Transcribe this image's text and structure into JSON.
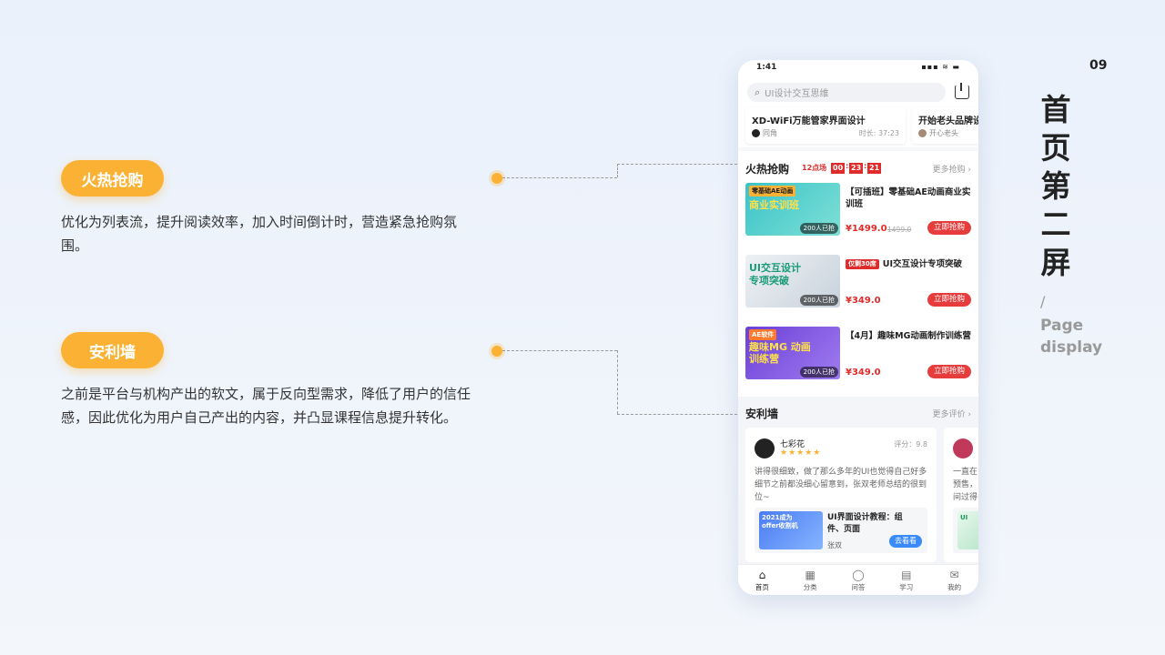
{
  "page_number": "09",
  "title_chars": [
    "首",
    "页",
    "第",
    "二",
    "屏"
  ],
  "subtitle_slash": "/",
  "subtitle_en": [
    "Page",
    "display"
  ],
  "annotations": [
    {
      "label": "火热抢购",
      "desc": "优化为列表流，提升阅读效率，加入时间倒计时，营造紧急抢购氛围。"
    },
    {
      "label": "安利墙",
      "desc": "之前是平台与机构产出的软文，属于反向型需求，降低了用户的信任感，因此优化为用户自己产出的内容，并凸显课程信息提升转化。"
    }
  ],
  "phone": {
    "status_time": "1:41",
    "status_icons": "▪▪▪ ≋ ▬",
    "search_placeholder": "UI设计交互思维",
    "search_icon": "search-icon",
    "download_icon": "download-icon",
    "course_strip": [
      {
        "title": "XD-WiFi万能管家界面设计",
        "author": "同角",
        "duration": "时长: 37:23"
      },
      {
        "title": "开始老头品牌设",
        "author": "开心老头",
        "duration": ""
      }
    ],
    "hot": {
      "title": "火热抢购",
      "session": "12点场",
      "countdown": [
        "00",
        "23",
        "21"
      ],
      "more": "更多抢购 ›",
      "items": [
        {
          "thumb_tag": "零基础AE动画",
          "thumb_big": "商业实训班",
          "sold": "200人已抢",
          "badge": "",
          "title": "【可插班】零基础AE动画商业实训班",
          "price": "¥1499.0",
          "orig": "1499.0",
          "button": "立即抢购",
          "colors": [
            "#3bc3c8",
            "#7ee0d6"
          ]
        },
        {
          "thumb_tag": "",
          "thumb_big": "UI交互设计 专项突破",
          "sold": "200人已抢",
          "badge": "仅剩30席",
          "title": "UI交互设计专项突破",
          "price": "¥349.0",
          "orig": "",
          "button": "立即抢购",
          "colors": [
            "#e9edf1",
            "#c8d2dc"
          ]
        },
        {
          "thumb_tag": "AE软件",
          "thumb_big": "趣味MG 动画训练营",
          "sold": "200人已抢",
          "badge": "",
          "title": "【4月】趣味MG动画制作训练营",
          "price": "¥349.0",
          "orig": "",
          "button": "立即抢购",
          "colors": [
            "#6b3fd6",
            "#9f7cf0"
          ]
        }
      ]
    },
    "anli": {
      "title": "安利墙",
      "more": "更多评价 ›",
      "reviews": [
        {
          "name": "七彩花",
          "stars": "★★★★★",
          "score": "评分：9.8",
          "text": "讲得很细致，做了那么多年的UI也觉得自己好多细节之前都没细心留意到，张双老师总结的很到位~",
          "course_thumb": "2021成为 offer收割机",
          "course_title": "UI界面设计教程：组件、页面",
          "teacher": "张双",
          "button": "去看看"
        },
        {
          "name": "",
          "stars": "",
          "score": "",
          "text": "一直在预售，间过得",
          "course_thumb": "UI",
          "course_title": "",
          "teacher": "",
          "button": ""
        }
      ]
    },
    "tabs": [
      {
        "label": "首页",
        "icon": "home-icon",
        "glyph": "⌂"
      },
      {
        "label": "分类",
        "icon": "grid-icon",
        "glyph": "▦"
      },
      {
        "label": "问答",
        "icon": "chat-icon",
        "glyph": "◯"
      },
      {
        "label": "学习",
        "icon": "book-icon",
        "glyph": "▤"
      },
      {
        "label": "我的",
        "icon": "user-icon",
        "glyph": "✉"
      }
    ]
  }
}
